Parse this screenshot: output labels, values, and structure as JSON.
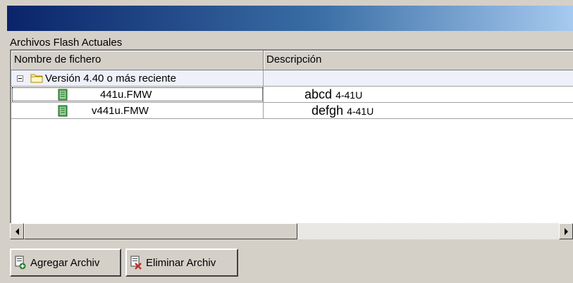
{
  "group_label": "Archivos Flash Actuales",
  "columns": [
    "Nombre de fichero",
    "Descripción"
  ],
  "group_row": {
    "label": "Versión 4.40 o más reciente"
  },
  "files": [
    {
      "name": "441u.FMW",
      "desc_main": "abcd",
      "desc_ver": "4-41U"
    },
    {
      "name": "v441u.FMW",
      "desc_main": "defgh",
      "desc_ver": "4-41U"
    }
  ],
  "buttons": {
    "add": "Agregar Archiv",
    "remove": "Eliminar Archiv"
  },
  "icons": {
    "folder": "folder-icon",
    "file": "firmware-file-icon",
    "add": "add-file-icon",
    "remove": "remove-file-icon"
  },
  "colors": {
    "title_start": "#0a246a",
    "title_end": "#a6caf0",
    "selection_row": "#eef0fa"
  }
}
